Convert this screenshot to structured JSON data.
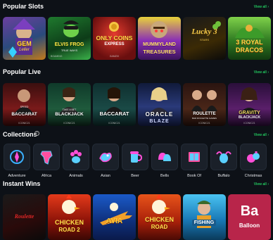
{
  "sections": {
    "popular_slots": {
      "title": "Popular Slots",
      "view_all": "View all ›",
      "games": [
        {
          "name": "GEM",
          "sub": "Leller",
          "provider": ""
        },
        {
          "name": "ELVIS FROG",
          "sub": "TRUE WAYS",
          "provider": "BGAMING"
        },
        {
          "name": "ONLY COINS",
          "sub": "EXPRESS",
          "provider": "GAMZIX"
        },
        {
          "name": "MUMMYLAND",
          "sub": "TREASURES",
          "provider": ""
        },
        {
          "name": "Lucky 3",
          "sub": "STARS",
          "provider": ""
        },
        {
          "name": "3 ROYAL",
          "sub": "DRACOS",
          "provider": ""
        }
      ]
    },
    "popular_live": {
      "title": "Popular Live",
      "view_all": "View all ›",
      "games": [
        {
          "name": "BACCARAT",
          "sub": "SPEED",
          "provider": "ICONIC21"
        },
        {
          "name": "BLACKJACK",
          "sub": "TAKE A BET",
          "provider": "ICONIC21"
        },
        {
          "name": "BACCARAT",
          "sub": "",
          "provider": "ICONIC21"
        },
        {
          "name": "ORACLE",
          "sub": "BLAZE",
          "provider": ""
        },
        {
          "name": "ROULETTE",
          "sub": "BAD ROULETTE GAMES",
          "provider": "ICONIC21"
        },
        {
          "name": "GRAVITY",
          "sub": "BLACKJACK",
          "provider": "ICONIC21"
        }
      ]
    },
    "collections": {
      "title": "Collections",
      "info": "i",
      "view_all": "View all ›",
      "items": [
        {
          "label": "Adventure",
          "icon": "compass-icon"
        },
        {
          "label": "Africa",
          "icon": "africa-map-icon"
        },
        {
          "label": "Animals",
          "icon": "paw-icon"
        },
        {
          "label": "Asian",
          "icon": "dragon-icon"
        },
        {
          "label": "Beer",
          "icon": "beer-mug-icon"
        },
        {
          "label": "Bells",
          "icon": "bells-icon"
        },
        {
          "label": "Book Of",
          "icon": "book-icon"
        },
        {
          "label": "Buffalo",
          "icon": "buffalo-icon"
        },
        {
          "label": "Christmas",
          "icon": "christmas-icon"
        }
      ]
    },
    "instant_wins": {
      "title": "Instant Wins",
      "view_all": "View all ›",
      "games": [
        {
          "name": "Roulette",
          "sub": "",
          "provider": ""
        },
        {
          "name": "CHICKEN",
          "sub": "ROAD 2",
          "provider": ""
        },
        {
          "name": "AVIA",
          "sub": "",
          "provider": ""
        },
        {
          "name": "CHICKEN",
          "sub": "ROAD",
          "provider": ""
        },
        {
          "name": "FISHING",
          "sub": "",
          "provider": ""
        },
        {
          "name": "Ba",
          "sub": "Balloon",
          "provider": ""
        }
      ]
    }
  },
  "colors": {
    "background": "#0d1117",
    "accent": "#22c55e",
    "card": "#1a2029"
  }
}
